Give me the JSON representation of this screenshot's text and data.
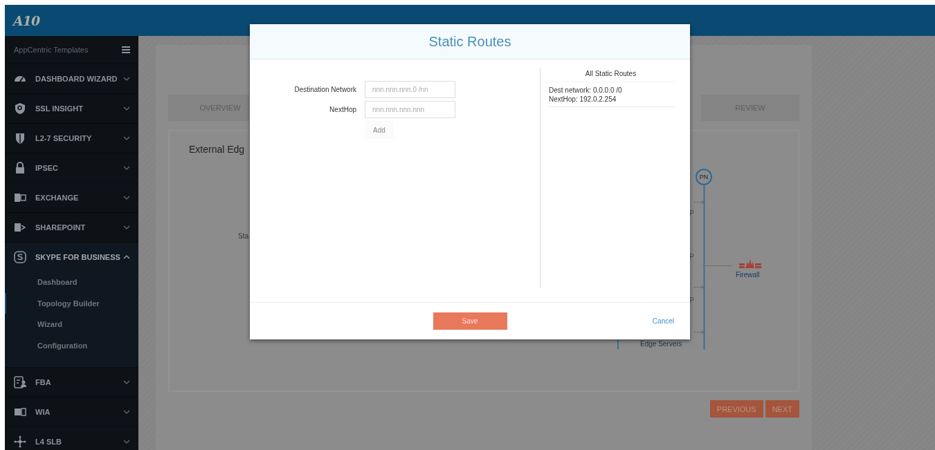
{
  "header": {
    "logo": "A10"
  },
  "sidebar": {
    "title": "AppCentric Templates",
    "items": [
      {
        "label": "DASHBOARD WIZARD",
        "expanded": false
      },
      {
        "label": "SSL INSIGHT",
        "expanded": false
      },
      {
        "label": "L2-7 SECURITY",
        "expanded": false
      },
      {
        "label": "IPSEC",
        "expanded": false
      },
      {
        "label": "EXCHANGE",
        "expanded": false
      },
      {
        "label": "SHAREPOINT",
        "expanded": false
      },
      {
        "label": "SKYPE FOR BUSINESS",
        "expanded": true,
        "children": [
          {
            "label": "Dashboard",
            "selected": false
          },
          {
            "label": "Topology Builder",
            "selected": true
          },
          {
            "label": "Wizard",
            "selected": false
          },
          {
            "label": "Configuration",
            "selected": false
          }
        ]
      },
      {
        "label": "FBA",
        "expanded": false
      },
      {
        "label": "WIA",
        "expanded": false
      },
      {
        "label": "L4 SLB",
        "expanded": false
      }
    ]
  },
  "wizard": {
    "tabs": [
      {
        "label": "OVERVIEW"
      },
      {
        "label": "REVIEW"
      }
    ],
    "panel_title": "External Edg",
    "diagram": {
      "side_label": "Sta",
      "node": "PN",
      "tap_labels": [
        "P",
        "P",
        "P"
      ],
      "firewall": "Firewall",
      "servers": "Edge Servers"
    },
    "buttons": [
      "PREVIOUS",
      "NEXT"
    ]
  },
  "modal": {
    "title": "Static Routes",
    "fields": [
      {
        "label": "Destination Network",
        "placeholder": "nnn.nnn.nnn.0 /nn"
      },
      {
        "label": "NextHop",
        "placeholder": "nnn.nnn.nnn.nnn"
      }
    ],
    "add_button": "Add",
    "routes_title": "All Static Routes",
    "routes": [
      {
        "dest": "Dest network: 0.0.0.0 /0",
        "nexthop": "NextHop: 192.0.2.254"
      }
    ],
    "save_button": "Save",
    "cancel_link": "Cancel"
  }
}
